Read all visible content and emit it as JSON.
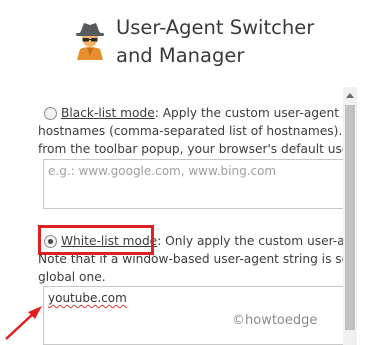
{
  "header": {
    "icon": "incognito-agent-icon",
    "title_line1": "User-Agent Switcher",
    "title_line2": "and Manager"
  },
  "blacklist": {
    "mode_label": "Black-list mode",
    "line1_rest": ": Apply the custom user-agent string t",
    "line2": "hostnames (comma-separated list of hostnames). Note t",
    "line3": "from the toolbar popup, your browser's default user-ag",
    "placeholder": "e.g.: www.google.com, www.bing.com",
    "selected": false
  },
  "whitelist": {
    "mode_label": "White-list mode",
    "line1_rest": ": Only apply the custom user-agent s",
    "line2": "Note that if a window-based user-agent string is set fron",
    "line3": "global one.",
    "value": "youtube.com",
    "selected": true
  },
  "annotation": {
    "highlight_color": "#e02020",
    "arrow_icon": "red-arrow-icon"
  },
  "watermark": "©howtoedge"
}
